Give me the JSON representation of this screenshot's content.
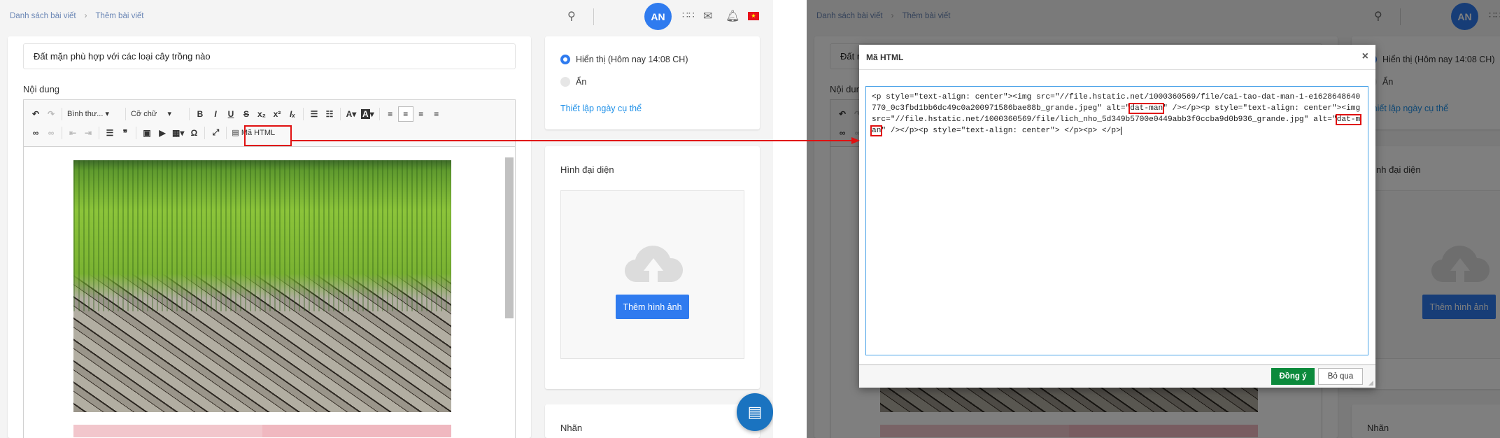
{
  "header": {
    "breadcrumb": [
      "Danh sách bài viết",
      "Thêm bài viết"
    ],
    "breadcrumb_sep": "›",
    "avatar": "AN",
    "flag": "★"
  },
  "post": {
    "title": "Đất mặn phù hợp với các loại cây trồng nào",
    "content_label": "Nội dung"
  },
  "toolbar": {
    "format": "Bình thư...",
    "font": "Cỡ chữ",
    "html_button": "Mã HTML"
  },
  "visibility": {
    "show": "Hiển thị (Hôm nay 14:08 CH)",
    "hide": "Ẩn",
    "schedule_link": "Thiết lập ngày cụ thể"
  },
  "thumbnail": {
    "title": "Hình đại diện",
    "add_button": "Thêm hình ảnh"
  },
  "tags": {
    "title": "Nhãn"
  },
  "modal": {
    "title": "Mã HTML",
    "code_parts": [
      "<p style=\"text-align: center\"><img src=\"//file.hstatic.net/1000360569/file/cai-tao-dat-man-1-e1628648640770_0c3fbd1bb6dc49c0a200971586bae88b_grande.jpeg\" alt=\"",
      "dat-man",
      "\" /></p><p style=\"text-align: center\"><img src=\"//file.hstatic.net/1000360569/file/lich_nho_5d349b5700e0449abb3f0ccba9d0b936_grande.jpg\" alt=\"",
      "dat-man",
      "\" /></p><p style=\"text-align: center\"> </p><p> </p>"
    ],
    "ok": "Đồng ý",
    "cancel": "Bỏ qua"
  },
  "colors": {
    "accent": "#2f7bef",
    "ok": "#0c8a3c",
    "highlight": "#e01010"
  }
}
